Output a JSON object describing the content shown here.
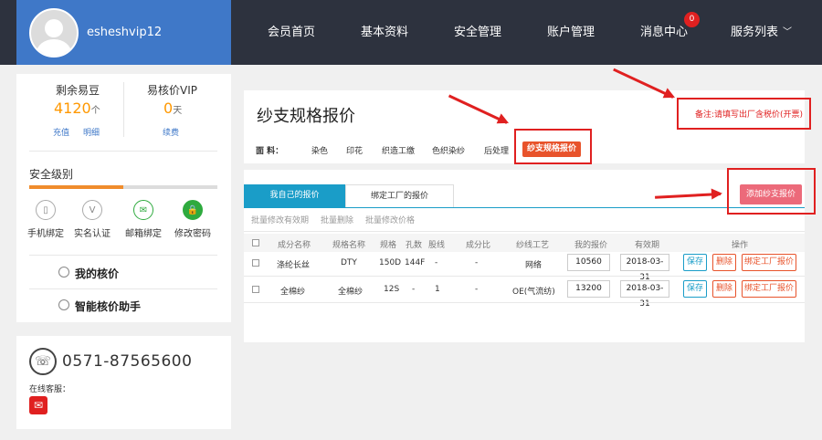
{
  "header": {
    "username": "esheshvip12",
    "nav": [
      "会员首页",
      "基本资料",
      "安全管理",
      "账户管理",
      "消息中心",
      "服务列表"
    ],
    "message_count": "0",
    "chevron": "chevron-down-icon"
  },
  "credits": {
    "left_label": "剩余易豆",
    "left_value": "4120",
    "left_unit": "个",
    "left_links": [
      "充值",
      "明细"
    ],
    "right_label": "易核价VIP",
    "right_value": "0",
    "right_unit": "天",
    "right_link": "续费"
  },
  "security": {
    "title": "安全级别",
    "level": 0.5,
    "items": [
      "手机绑定",
      "实名认证",
      "邮箱绑定",
      "修改密码"
    ]
  },
  "menu": [
    "我的核价",
    "智能核价助手"
  ],
  "contact": {
    "phone": "0571-87565600",
    "online_label": "在线客服："
  },
  "main": {
    "title": "纱支规格报价",
    "note": "备注:请填写出厂含税价(开票)",
    "category_label": "面    料：",
    "categories": [
      "染色",
      "印花",
      "织造工缴",
      "色织染纱",
      "后处理"
    ],
    "active_category": "纱支规格报价",
    "tabs": [
      "我自己的报价",
      "绑定工厂的报价"
    ],
    "add_button": "添加纱支报价",
    "bulk_actions": [
      "批量修改有效期",
      "批量删除",
      "批量修改价格"
    ],
    "columns": [
      "成分名称",
      "规格名称",
      "规格",
      "孔数",
      "股线",
      "成分比",
      "纱线工艺",
      "我的报价",
      "有效期",
      "操作"
    ],
    "rows": [
      {
        "component": "涤纶长丝",
        "spec_name": "DTY",
        "spec": "150D",
        "holes": "144F",
        "ply": "-",
        "ratio": "-",
        "process": "网络",
        "price": "10560",
        "expiry": "2018-03-31"
      },
      {
        "component": "全棉纱",
        "spec_name": "全棉纱",
        "spec": "12S",
        "holes": "-",
        "ply": "1",
        "ratio": "-",
        "process": "OE(气流纺)",
        "price": "13200",
        "expiry": "2018-03-31"
      }
    ],
    "row_actions": [
      "保存",
      "删除",
      "绑定工厂报价"
    ]
  }
}
